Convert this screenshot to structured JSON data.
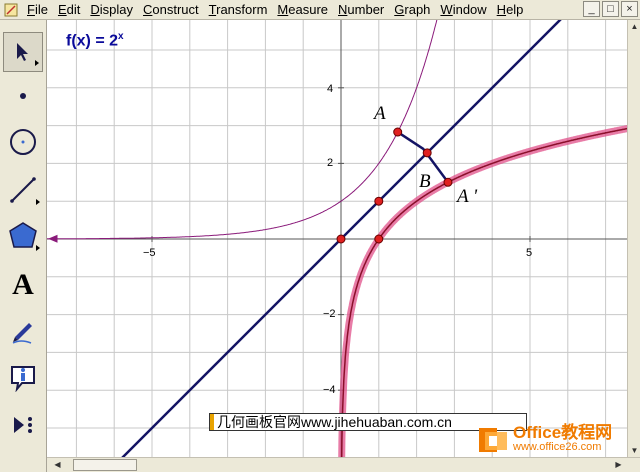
{
  "menu": {
    "items": [
      {
        "underline": "F",
        "rest": "ile"
      },
      {
        "underline": "E",
        "rest": "dit"
      },
      {
        "underline": "D",
        "rest": "isplay"
      },
      {
        "underline": "C",
        "rest": "onstruct"
      },
      {
        "underline": "T",
        "rest": "ransform"
      },
      {
        "underline": "M",
        "rest": "easure"
      },
      {
        "underline": "N",
        "rest": "umber"
      },
      {
        "underline": "G",
        "rest": "raph"
      },
      {
        "underline": "W",
        "rest": "indow"
      },
      {
        "underline": "H",
        "rest": "elp"
      }
    ],
    "window_buttons": [
      "_",
      "□",
      "×"
    ]
  },
  "toolbox": {
    "tools": [
      "arrow-select",
      "point",
      "compass",
      "straightedge",
      "polygon",
      "text",
      "marker",
      "information",
      "custom-tools"
    ],
    "text_tool_glyph": "A"
  },
  "graph": {
    "function_label": {
      "name": "f(x) = 2",
      "exponent": "x"
    },
    "x_ticks": [
      {
        "value": -5,
        "label": "−5"
      },
      {
        "value": 5,
        "label": "5"
      }
    ],
    "y_ticks": [
      {
        "value": 4,
        "label": "4"
      },
      {
        "value": 2,
        "label": "2"
      },
      {
        "value": -2,
        "label": "−2"
      },
      {
        "value": -4,
        "label": "−4"
      }
    ],
    "point_labels": {
      "A": "A",
      "B": "B",
      "A_prime": "A '"
    },
    "points": {
      "A": [
        1.5,
        2.83
      ],
      "B": [
        2.28,
        2.28
      ],
      "A_prime": [
        2.83,
        1.5
      ]
    },
    "colors": {
      "navy": "#141464",
      "curve_purple": "#8a1a7a",
      "highlight": "#e0508a",
      "point_red": "#e02020",
      "grid": "#c8c8c8"
    }
  },
  "watermark": {
    "text": "几何画板官网www.jihehuaban.com.cn"
  },
  "logo": {
    "brand": "Office教程网",
    "url": "www.office26.com"
  }
}
